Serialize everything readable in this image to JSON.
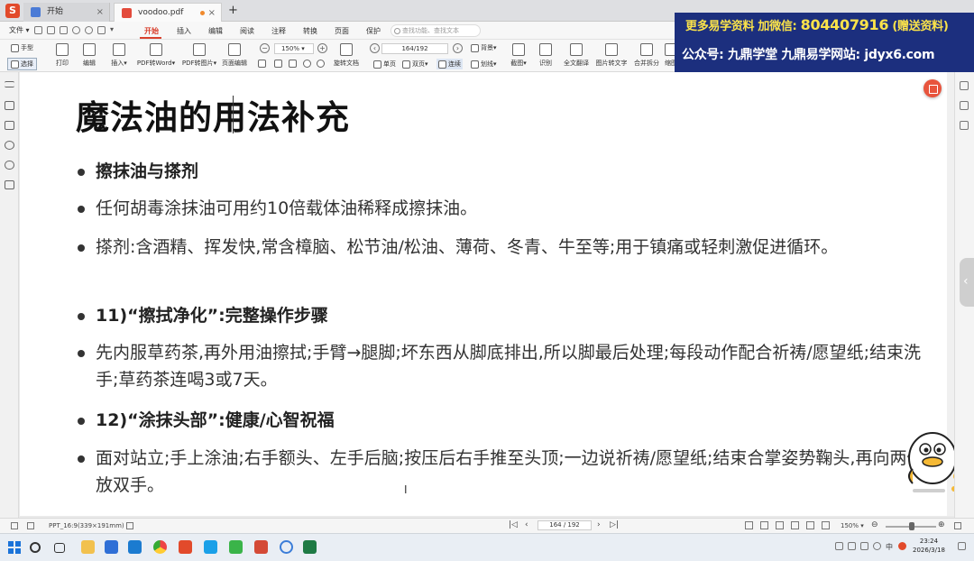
{
  "tabs": {
    "home_label": "开始",
    "doc_label": "voodoo.pdf",
    "new_tab_symbol": "+"
  },
  "menu": {
    "file_label": "文件",
    "items": [
      "开始",
      "插入",
      "编辑",
      "阅读",
      "注释",
      "转换",
      "页面",
      "保护"
    ],
    "active_index": 0,
    "search_placeholder": "查找功能、查找文本"
  },
  "toolbar": {
    "hand_label": "手型",
    "select_label": "选择",
    "print_label": "打印",
    "edit_label": "编辑",
    "insert_label": "插入",
    "pdf_to_word_label": "PDF转Word",
    "pdf_to_image_label": "PDF转图片",
    "page_edit_label": "页面编辑",
    "zoom_value": "150%",
    "page_value": "164/192",
    "rotate_label": "旋转文档",
    "single_label": "单页",
    "double_label": "双页",
    "continuous_label": "连续",
    "bg_label": "背景",
    "highlight_label": "划线",
    "screenshot_label": "截图",
    "compare_label": "识别",
    "translate_label": "全文翻译",
    "image_to_text_label": "图片转文字",
    "merge_label": "合并拆分",
    "thumbnail_label": "缩图"
  },
  "banner": {
    "line1_prefix": "更多易学资料 加微信:",
    "line1_number": "804407916",
    "line1_suffix": "(赠送资料)",
    "line2": "公众号: 九鼎学堂 九鼎易学网站: jdyx6.com"
  },
  "slide": {
    "title": "魔法油的用法补充",
    "bullets": [
      {
        "text": "擦抹油与搽剂",
        "bold": true
      },
      {
        "text": "任何胡毒涂抹油可用约10倍载体油稀释成擦抹油。",
        "bold": false
      },
      {
        "text": "搽剂:含酒精、挥发快,常含樟脑、松节油/松油、薄荷、冬青、牛至等;用于镇痛或轻刺激促进循环。",
        "bold": false
      },
      {
        "text": "11)“擦拭净化”:完整操作步骤",
        "bold": true
      },
      {
        "text": "先内服草药茶,再外用油擦拭;手臂→腿脚;坏东西从脚底排出,所以脚最后处理;每段动作配合祈祷/愿望纸;结束洗手;草药茶连喝3或7天。",
        "bold": false
      },
      {
        "text": "12)“涂抹头部”:健康/心智祝福",
        "bold": true
      },
      {
        "text": "面对站立;手上涂油;右手额头、左手后脑;按压后右手推至头顶;一边说祈祷/愿望纸;结束合掌姿势鞠头,再向两侧释放双手。",
        "bold": false
      }
    ],
    "text_cursor": "I"
  },
  "statusbar": {
    "page_size": "PPT_16:9(339×191mm)",
    "page_value": "164 / 192",
    "zoom_value": "150%"
  },
  "taskbar": {
    "time": "23:24",
    "date": "2026/3/18",
    "lang": "中"
  },
  "colors": {
    "accent": "#d9412e",
    "banner_bg": "#1c2f7e",
    "banner_highlight": "#fbe34a"
  }
}
